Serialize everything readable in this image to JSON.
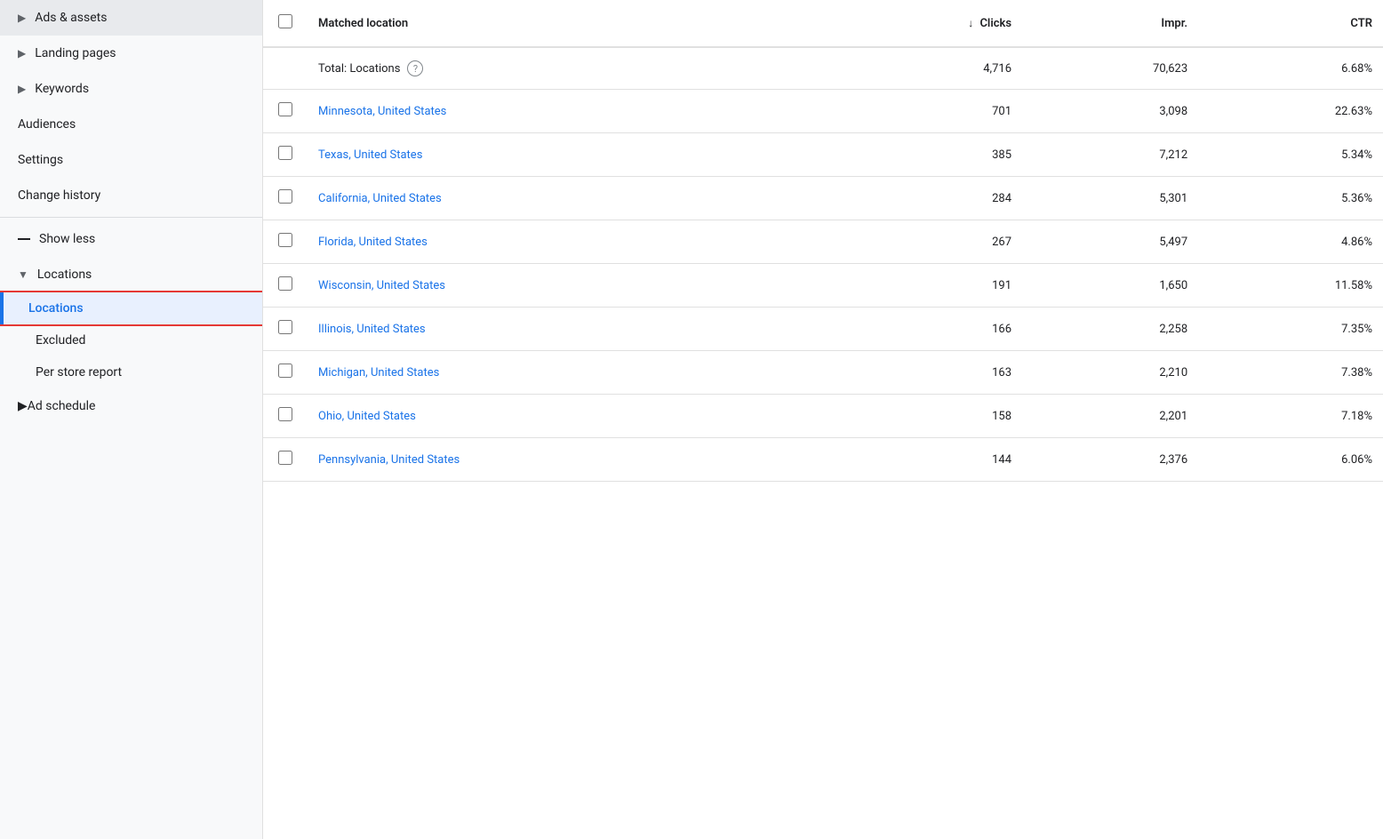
{
  "sidebar": {
    "items": [
      {
        "id": "ads-assets",
        "label": "Ads & assets",
        "type": "expandable",
        "chevron": "▶"
      },
      {
        "id": "landing-pages",
        "label": "Landing pages",
        "type": "expandable",
        "chevron": "▶"
      },
      {
        "id": "keywords",
        "label": "Keywords",
        "type": "expandable",
        "chevron": "▶"
      },
      {
        "id": "audiences",
        "label": "Audiences",
        "type": "plain"
      },
      {
        "id": "settings",
        "label": "Settings",
        "type": "plain"
      },
      {
        "id": "change-history",
        "label": "Change history",
        "type": "plain"
      }
    ],
    "show_less_label": "Show less",
    "locations_group": {
      "parent_label": "Locations",
      "chevron": "▼",
      "children": [
        {
          "id": "locations",
          "label": "Locations",
          "active": true
        },
        {
          "id": "excluded",
          "label": "Excluded"
        },
        {
          "id": "per-store-report",
          "label": "Per store report"
        }
      ]
    },
    "ad_schedule": {
      "label": "Ad schedule",
      "chevron": "▶"
    }
  },
  "table": {
    "columns": [
      {
        "id": "checkbox",
        "label": ""
      },
      {
        "id": "matched-location",
        "label": "Matched location"
      },
      {
        "id": "clicks",
        "label": "Clicks",
        "sorted": true,
        "sort_dir": "desc"
      },
      {
        "id": "impr",
        "label": "Impr."
      },
      {
        "id": "ctr",
        "label": "CTR"
      }
    ],
    "total_row": {
      "label": "Total: Locations",
      "clicks": "4,716",
      "impr": "70,623",
      "ctr": "6.68%"
    },
    "rows": [
      {
        "location": "Minnesota, United States",
        "clicks": "701",
        "impr": "3,098",
        "ctr": "22.63%"
      },
      {
        "location": "Texas, United States",
        "clicks": "385",
        "impr": "7,212",
        "ctr": "5.34%"
      },
      {
        "location": "California, United States",
        "clicks": "284",
        "impr": "5,301",
        "ctr": "5.36%"
      },
      {
        "location": "Florida, United States",
        "clicks": "267",
        "impr": "5,497",
        "ctr": "4.86%"
      },
      {
        "location": "Wisconsin, United States",
        "clicks": "191",
        "impr": "1,650",
        "ctr": "11.58%"
      },
      {
        "location": "Illinois, United States",
        "clicks": "166",
        "impr": "2,258",
        "ctr": "7.35%"
      },
      {
        "location": "Michigan, United States",
        "clicks": "163",
        "impr": "2,210",
        "ctr": "7.38%"
      },
      {
        "location": "Ohio, United States",
        "clicks": "158",
        "impr": "2,201",
        "ctr": "7.18%"
      },
      {
        "location": "Pennsylvania, United States",
        "clicks": "144",
        "impr": "2,376",
        "ctr": "6.06%"
      }
    ]
  }
}
